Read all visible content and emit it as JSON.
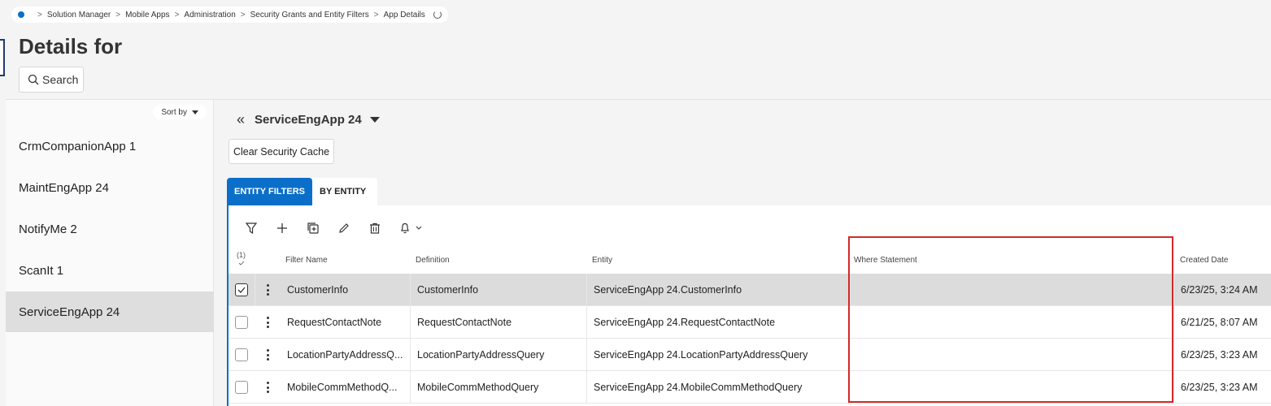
{
  "breadcrumb": {
    "items": [
      "Solution Manager",
      "Mobile Apps",
      "Administration",
      "Security Grants and Entity Filters",
      "App Details"
    ],
    "separator": ">"
  },
  "page": {
    "title": "Details for"
  },
  "search": {
    "label": "Search"
  },
  "sidebar": {
    "sort_label": "Sort by",
    "items": [
      {
        "label": "CrmCompanionApp 1"
      },
      {
        "label": "MaintEngApp 24"
      },
      {
        "label": "NotifyMe 2"
      },
      {
        "label": "ScanIt 1"
      },
      {
        "label": "ServiceEngApp 24"
      }
    ]
  },
  "main": {
    "app_name": "ServiceEngApp 24",
    "collapse_glyph": "«",
    "clear_cache_label": "Clear Security Cache",
    "tabs": [
      {
        "label": "ENTITY FILTERS"
      },
      {
        "label": "BY ENTITY"
      }
    ],
    "toolbar_icons": [
      "filter-icon",
      "plus-icon",
      "duplicate-icon",
      "pencil-icon",
      "trash-icon",
      "bell-icon"
    ],
    "selection_count": "(1)",
    "columns": [
      "Filter Name",
      "Definition",
      "Entity",
      "Where Statement",
      "Created Date"
    ],
    "rows": [
      {
        "filter_name": "CustomerInfo",
        "definition": "CustomerInfo",
        "entity": "ServiceEngApp 24.CustomerInfo",
        "where": "",
        "created": "6/23/25, 3:24 AM",
        "checked": true
      },
      {
        "filter_name": "RequestContactNote",
        "definition": "RequestContactNote",
        "entity": "ServiceEngApp 24.RequestContactNote",
        "where": "",
        "created": "6/21/25, 8:07 AM",
        "checked": false
      },
      {
        "filter_name": "LocationPartyAddressQ...",
        "definition": "LocationPartyAddressQuery",
        "entity": "ServiceEngApp 24.LocationPartyAddressQuery",
        "where": "",
        "created": "6/23/25, 3:23 AM",
        "checked": false
      },
      {
        "filter_name": "MobileCommMethodQ...",
        "definition": "MobileCommMethodQuery",
        "entity": "ServiceEngApp 24.MobileCommMethodQuery",
        "where": "",
        "created": "6/23/25, 3:23 AM",
        "checked": false
      }
    ]
  },
  "colors": {
    "accent": "#0b6fc9",
    "highlight": "#d42a2a",
    "selected_row": "#dcdcdc"
  }
}
